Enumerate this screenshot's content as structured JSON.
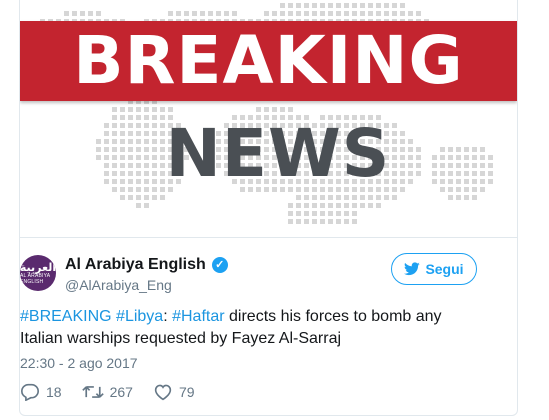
{
  "media": {
    "headline_top": "BREAKING",
    "headline_bottom": "NEWS",
    "banner_color": "#c3242f",
    "map_dot_color": "#d6d6d6"
  },
  "author": {
    "avatar_ar": "العربية",
    "avatar_en": "AL ARABIYA ENGLISH",
    "name": "Al Arabiya English",
    "handle": "@AlArabiya_Eng",
    "verified_icon": "verified-badge-icon"
  },
  "follow_button": {
    "label": "Segui",
    "icon": "twitter-bird-icon",
    "color": "#1da1f2"
  },
  "tweet": {
    "tag1": "#BREAKING",
    "space1": " ",
    "tag2": "#Libya",
    "colon": ": ",
    "tag3": "#Haftar",
    "text": " directs his forces to bomb any Italian warships requested by Fayez Al-Sarraj",
    "hashtag_color": "#1b95e0"
  },
  "timestamp": "22:30 - 2 ago 2017",
  "actions": {
    "replies": "18",
    "retweets": "267",
    "likes": "79"
  }
}
